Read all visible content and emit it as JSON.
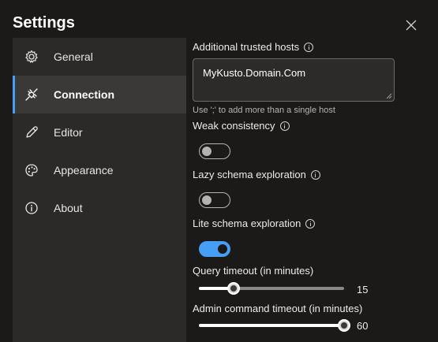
{
  "dialog": {
    "title": "Settings"
  },
  "sidebar": {
    "items": [
      {
        "label": "General",
        "icon": "gear-icon",
        "active": false
      },
      {
        "label": "Connection",
        "icon": "plug-icon",
        "active": true
      },
      {
        "label": "Editor",
        "icon": "pencil-icon",
        "active": false
      },
      {
        "label": "Appearance",
        "icon": "palette-icon",
        "active": false
      },
      {
        "label": "About",
        "icon": "info-icon",
        "active": false
      }
    ]
  },
  "connection": {
    "trusted_hosts": {
      "label": "Additional trusted hosts",
      "value": "MyKusto.Domain.Com",
      "hint": "Use ';' to add more than a single host"
    },
    "weak_consistency": {
      "label": "Weak consistency",
      "on": false
    },
    "lazy_schema": {
      "label": "Lazy schema exploration",
      "on": false
    },
    "lite_schema": {
      "label": "Lite schema exploration",
      "on": true
    },
    "query_timeout": {
      "label": "Query timeout (in minutes)",
      "value": "15",
      "fraction": 0.24
    },
    "admin_timeout": {
      "label": "Admin command timeout (in minutes)",
      "value": "60",
      "fraction": 1.0
    }
  },
  "colors": {
    "accent": "#479ef5",
    "background": "#1b1a19",
    "sidebar": "#2b2a29"
  }
}
